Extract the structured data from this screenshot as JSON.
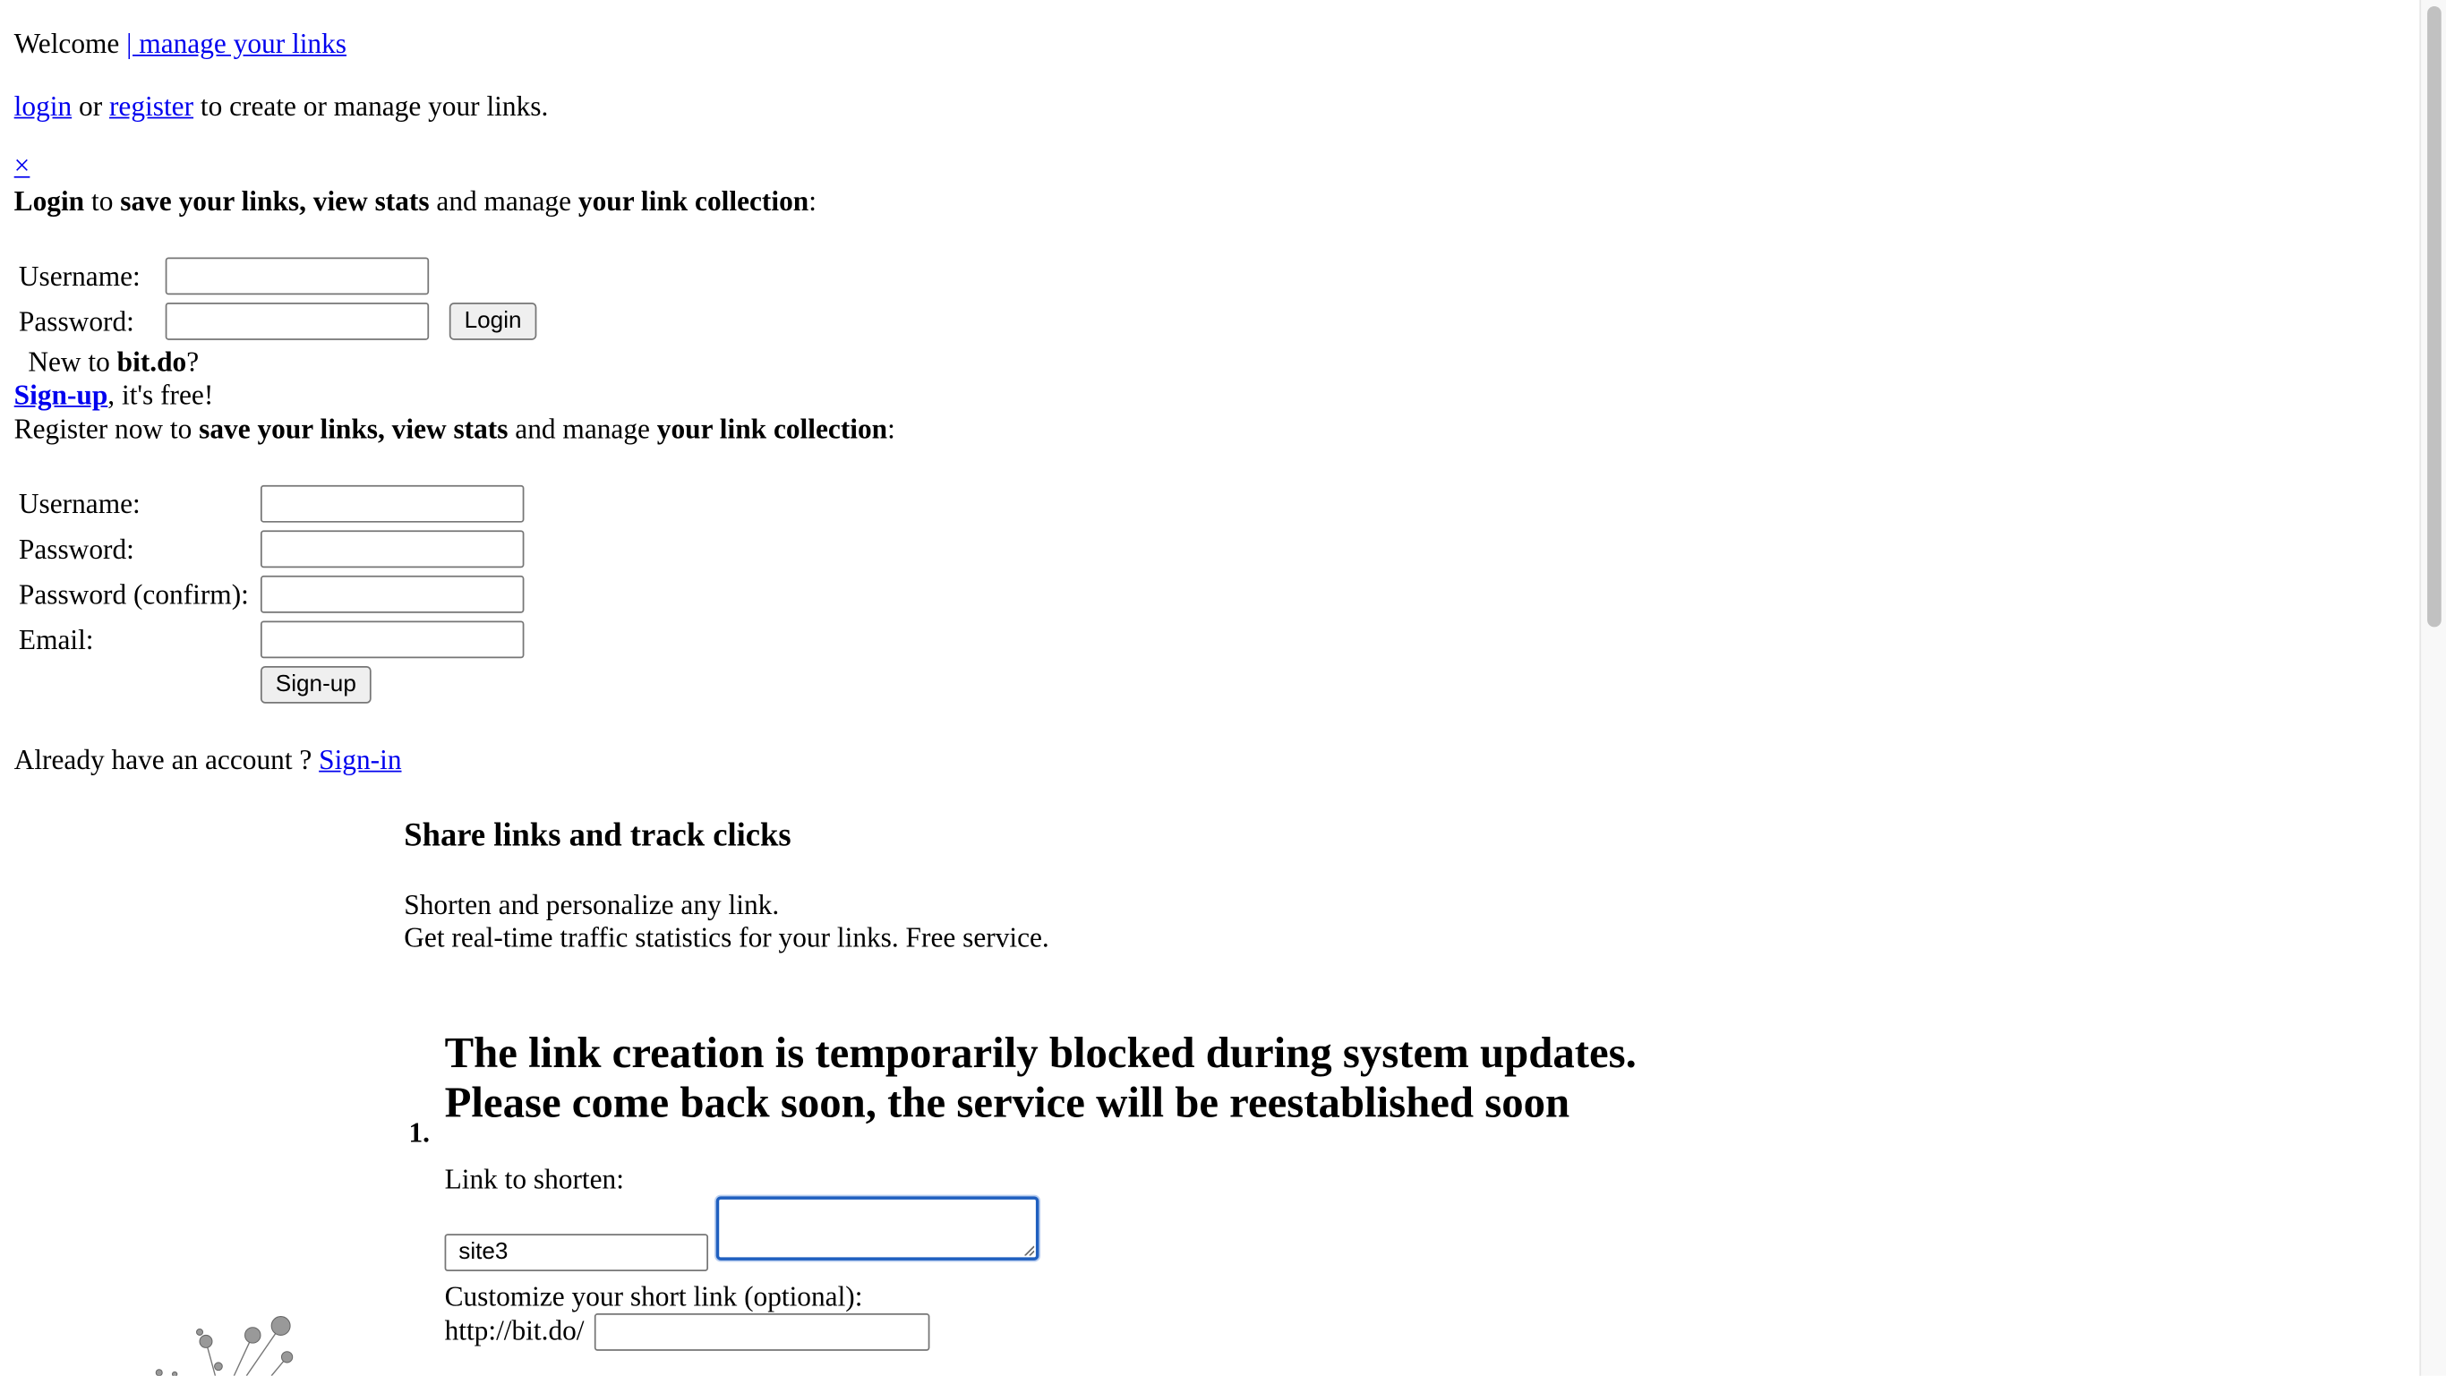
{
  "header": {
    "welcome": "Welcome",
    "manage_link": "| manage your links"
  },
  "auth_prompt": {
    "login": "login",
    "or": "or",
    "register": "register",
    "suffix": "to create or manage your links."
  },
  "login_box": {
    "close": "×",
    "intro_strong1": "Login",
    "intro_text1": "to",
    "intro_strong2": "save your links, view stats",
    "intro_text2": "and manage",
    "intro_strong3": "your link collection",
    "intro_colon": ":",
    "username_label": "Username:",
    "password_label": "Password:",
    "login_button": "Login",
    "new_to": "New to",
    "site_name": "bit.do",
    "question": "?"
  },
  "signup_box": {
    "signup_link": "Sign-up",
    "free_text": ", it's free!",
    "intro_text1": "Register now to",
    "intro_strong2": "save your links, view stats",
    "intro_text2": "and manage",
    "intro_strong3": "your link collection",
    "intro_colon": ":",
    "username_label": "Username:",
    "password_label": "Password:",
    "confirm_label": "Password (confirm):",
    "email_label": "Email:",
    "signup_button": "Sign-up",
    "already_text": "Already have an account ?",
    "signin_link": "Sign-in"
  },
  "hero": {
    "title": "Share links and track clicks",
    "line1": "Shorten and personalize any link.",
    "line2": "Get real-time traffic statistics for your links. Free service."
  },
  "step1": {
    "number": "1.",
    "notice_line1": "The link creation is temporarily blocked during system updates.",
    "notice_line2": "Please come back soon, the service will be reestablished soon",
    "link_label": "Link to shorten:",
    "site_value": "site3",
    "customize_label": "Customize your short link (optional):",
    "prefix": "http://bit.do/"
  }
}
